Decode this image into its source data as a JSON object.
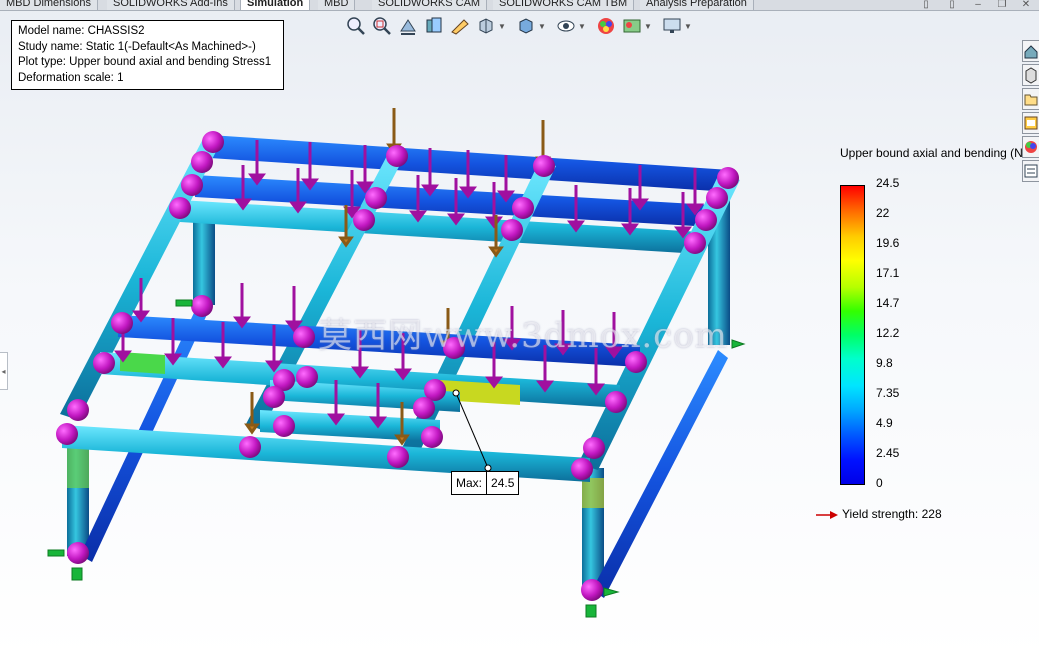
{
  "tabs": [
    {
      "label": "MBD Dimensions",
      "active": false
    },
    {
      "label": "SOLIDWORKS Add-Ins",
      "active": false
    },
    {
      "label": "Simulation",
      "active": true
    },
    {
      "label": "MBD",
      "active": false
    },
    {
      "label": "SOLIDWORKS CAM",
      "active": false
    },
    {
      "label": "SOLIDWORKS CAM TBM",
      "active": false
    },
    {
      "label": "Analysis Preparation",
      "active": false
    }
  ],
  "info": {
    "model_name": "Model name: CHASSIS2",
    "study_name": "Study name: Static 1(-Default<As Machined>-)",
    "plot_type": "Plot type: Upper bound axial and bending Stress1",
    "deformation_scale": "Deformation scale: 1"
  },
  "hud_icons": [
    "zoom-to-fit-icon",
    "zoom-to-area-icon",
    "previous-view-icon",
    "section-view-icon",
    "dynamic-annotation-icon",
    "view-orientation-icon",
    "display-style-icon",
    "hide-show-icon",
    "edit-appearance-icon",
    "apply-scene-icon",
    "view-settings-icon"
  ],
  "taskpane_icons": [
    "home-icon",
    "design-library-icon",
    "file-explorer-icon",
    "custom-properties-icon",
    "appearances-icon",
    "view-palette-icon"
  ],
  "legend": {
    "title": "Upper bound axial and bending (N",
    "ticks": [
      "24.5",
      "22",
      "19.6",
      "17.1",
      "14.7",
      "12.2",
      "9.8",
      "7.35",
      "4.9",
      "2.45",
      "0"
    ],
    "yield": "Yield strength: 228",
    "colors": {
      "max": "#ff0000",
      "min": "#0000e8",
      "arrow": "#cc0000"
    }
  },
  "probe": {
    "label": "Max:",
    "value": "24.5"
  },
  "watermark": "莫西网www.3dmox.com",
  "colors": {
    "load_arrow": "#a0109f",
    "fixture": "#c010c0",
    "gravity": "#8a5a16"
  }
}
